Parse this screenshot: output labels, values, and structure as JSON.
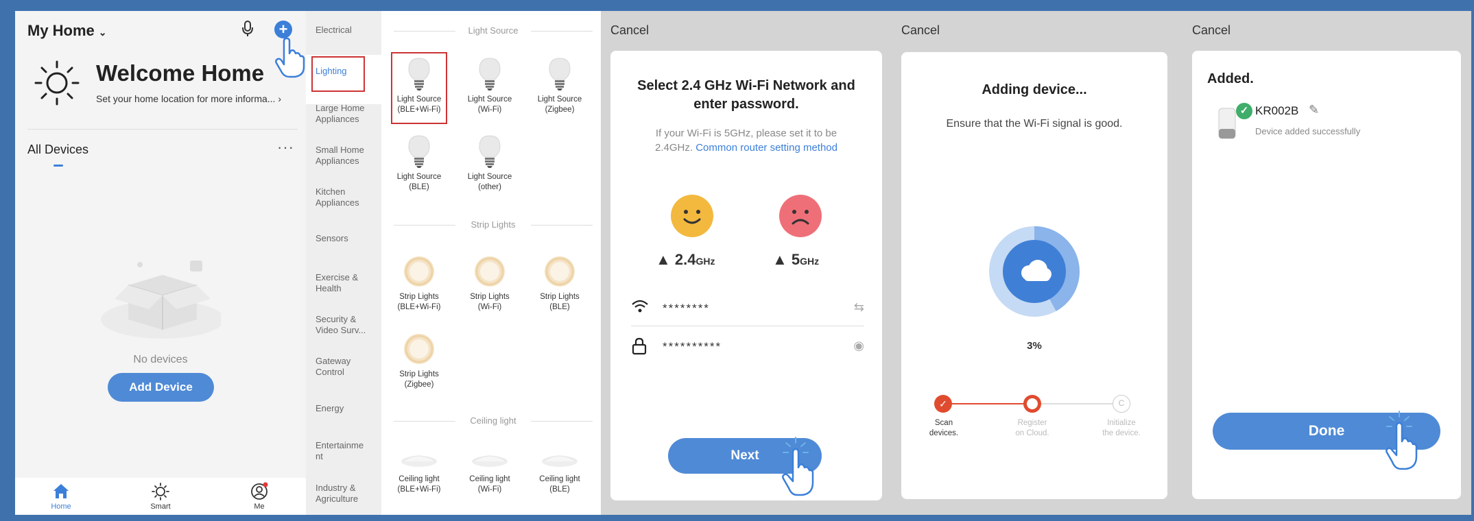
{
  "colors": {
    "frame": "#3f72ad",
    "accent": "#4f8ad6",
    "highlight_box": "#cc3333",
    "success": "#3fae6a",
    "progress_active": "#e04b2f"
  },
  "home": {
    "title": "My Home",
    "welcome": "Welcome Home",
    "subtitle": "Set your home location for more informa...",
    "all_devices": "All Devices",
    "more": "···",
    "empty": "No devices",
    "add_device": "Add Device",
    "tabs": [
      "Home",
      "Smart",
      "Me"
    ]
  },
  "categories": {
    "sidebar": [
      "Electrical",
      "Lighting",
      "Large Home Appliances",
      "Small Home Appliances",
      "Kitchen Appliances",
      "Sensors",
      "Exercise & Health",
      "Security & Video Surv...",
      "Gateway Control",
      "Energy",
      "Entertainme nt",
      "Industry & Agriculture"
    ],
    "active": "Lighting",
    "sections": [
      {
        "title": "Light Source",
        "items": [
          [
            "Light Source",
            "(BLE+Wi-Fi)"
          ],
          [
            "Light Source",
            "(Wi-Fi)"
          ],
          [
            "Light Source",
            "(Zigbee)"
          ],
          [
            "Light Source",
            "(BLE)"
          ],
          [
            "Light Source",
            "(other)"
          ]
        ]
      },
      {
        "title": "Strip Lights",
        "items": [
          [
            "Strip Lights",
            "(BLE+Wi-Fi)"
          ],
          [
            "Strip Lights",
            "(Wi-Fi)"
          ],
          [
            "Strip Lights",
            "(BLE)"
          ],
          [
            "Strip Lights",
            "(Zigbee)"
          ]
        ]
      },
      {
        "title": "Ceiling light",
        "items": [
          [
            "Ceiling light",
            "(BLE+Wi-Fi)"
          ],
          [
            "Ceiling light",
            "(Wi-Fi)"
          ],
          [
            "Ceiling light",
            "(BLE)"
          ]
        ]
      }
    ]
  },
  "wifi": {
    "cancel": "Cancel",
    "title_line1": "Select 2.4 GHz Wi-Fi Network and",
    "title_line2": "enter password.",
    "hint_line1": "If your Wi-Fi is 5GHz, please set it to be",
    "hint_line2_prefix": "2.4GHz.",
    "hint_link": "Common router setting method",
    "band_good": "2.4",
    "band_bad": "5",
    "band_unit": "GHz",
    "ssid": "********",
    "password": "**********",
    "next": "Next"
  },
  "adding": {
    "cancel": "Cancel",
    "title": "Adding device...",
    "subtitle": "Ensure that the Wi-Fi signal is good.",
    "progress": "3%",
    "progress_value": 0.03,
    "steps": [
      [
        "Scan",
        "devices."
      ],
      [
        "Register",
        "on Cloud."
      ],
      [
        "Initialize",
        "the device."
      ]
    ],
    "step_glyph_3": "C"
  },
  "added": {
    "cancel": "Cancel",
    "title": "Added.",
    "device_name": "KR002B",
    "message": "Device added successfully",
    "done": "Done"
  }
}
